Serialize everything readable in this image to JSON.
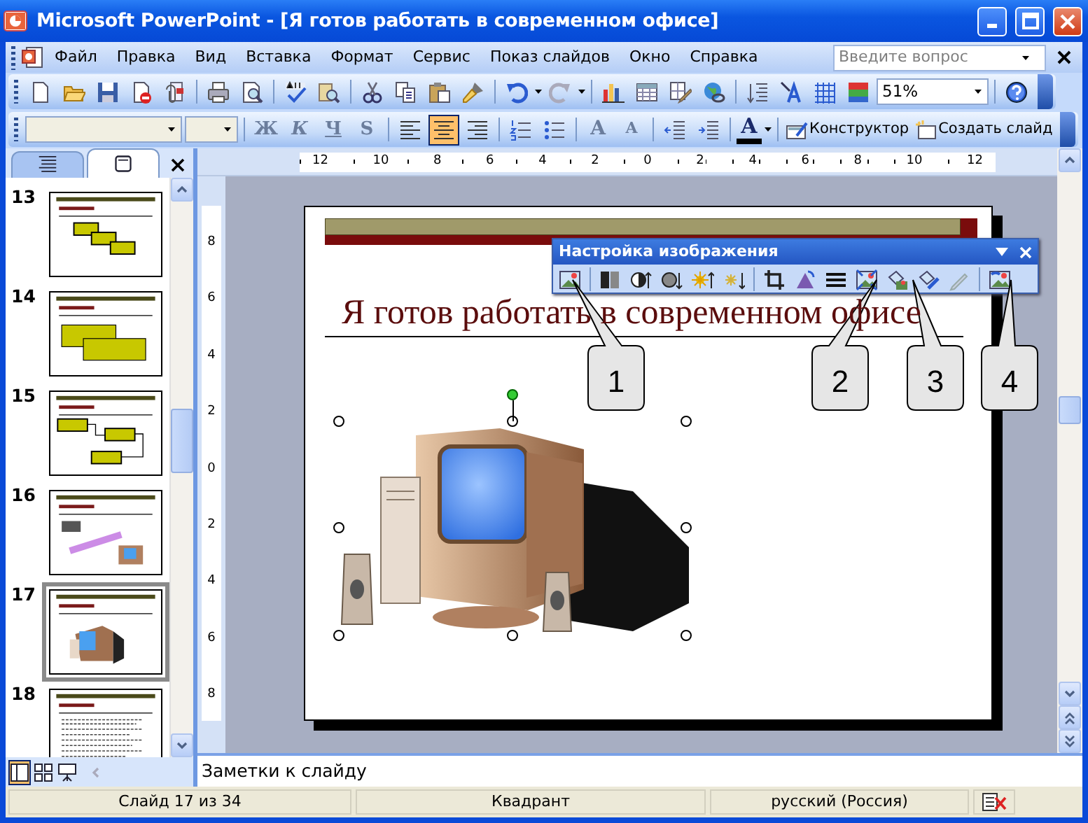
{
  "window": {
    "title": "Microsoft PowerPoint - [Я готов работать в современном офисе]"
  },
  "menu": [
    "Файл",
    "Правка",
    "Вид",
    "Вставка",
    "Формат",
    "Сервис",
    "Показ слайдов",
    "Окно",
    "Справка"
  ],
  "help_search": {
    "placeholder": "Введите вопрос"
  },
  "zoom": {
    "value": "51%"
  },
  "format_buttons": [
    "Ж",
    "К",
    "Ч",
    "S"
  ],
  "alignment": [
    {
      "selected": false
    },
    {
      "selected": true
    },
    {
      "selected": false
    }
  ],
  "font_size_buttons": [
    "A",
    "A"
  ],
  "font_color": {
    "label": "A"
  },
  "design_buttons": [
    "Конструктор",
    "Создать слайд"
  ],
  "pane_tabs": [
    {
      "selected": false
    },
    {
      "selected": true
    }
  ],
  "slides": [
    {
      "number": "13",
      "kind": "diagram",
      "selected": false
    },
    {
      "number": "14",
      "kind": "boxes",
      "selected": false
    },
    {
      "number": "15",
      "kind": "flow",
      "selected": false
    },
    {
      "number": "16",
      "kind": "wordart",
      "selected": false
    },
    {
      "number": "17",
      "kind": "picture",
      "selected": true
    },
    {
      "number": "18",
      "kind": "text",
      "selected": false
    }
  ],
  "view_buttons": [
    {
      "selected": true
    },
    {
      "selected": false
    },
    {
      "selected": false
    }
  ],
  "ruler": {
    "horizontal": [
      "12",
      "10",
      "8",
      "6",
      "4",
      "2",
      "0",
      "2",
      "4",
      "6",
      "8",
      "10",
      "12"
    ],
    "vertical": [
      "8",
      "6",
      "4",
      "2",
      "0",
      "2",
      "4",
      "6",
      "8"
    ]
  },
  "slide": {
    "title": "Я готов работать в современном офисе"
  },
  "picture_toolbar": {
    "title": "Настройка изображения"
  },
  "callouts": [
    "1",
    "2",
    "3",
    "4"
  ],
  "notes": {
    "placeholder": "Заметки к слайду"
  },
  "status_bar": [
    "Слайд 17 из 34",
    "Квадрант",
    "русский (Россия)"
  ]
}
